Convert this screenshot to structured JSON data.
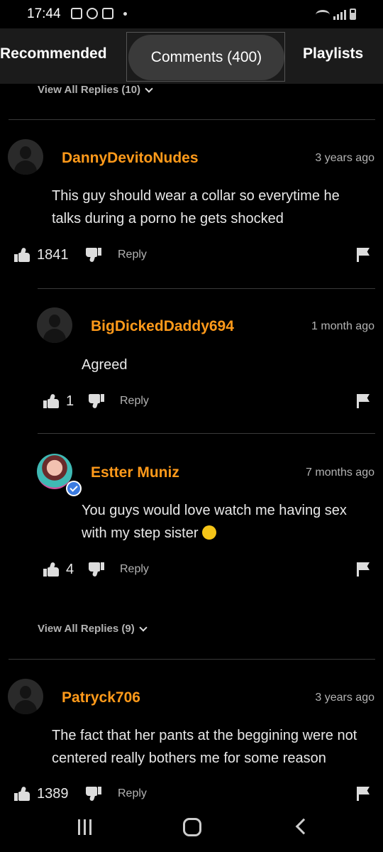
{
  "status_bar": {
    "time": "17:44"
  },
  "tabs": {
    "recommended": "Recommended",
    "comments": "Comments (400)",
    "playlists": "Playlists"
  },
  "top_view_replies": "View All Replies (10)",
  "comments": [
    {
      "username": "DannyDevitoNudes",
      "time": "3 years ago",
      "text": "This guy should wear a collar so everytime he talks during a porno he gets shocked",
      "likes": "1841",
      "reply_label": "Reply"
    },
    {
      "username": "BigDickedDaddy694",
      "time": "1 month ago",
      "text": "Agreed",
      "likes": "1",
      "reply_label": "Reply"
    },
    {
      "username": "Estter Muniz",
      "time": "7 months ago",
      "text": "You guys would love watch me having sex with my step sister",
      "likes": "4",
      "reply_label": "Reply"
    },
    {
      "username": "Patryck706",
      "time": "3 years ago",
      "text": "The fact that her pants at the beggining were not centered really bothers me for some reason",
      "likes": "1389",
      "reply_label": "Reply"
    }
  ],
  "mid_view_replies": "View All Replies (9)",
  "accent_color": "#ff9a1a"
}
